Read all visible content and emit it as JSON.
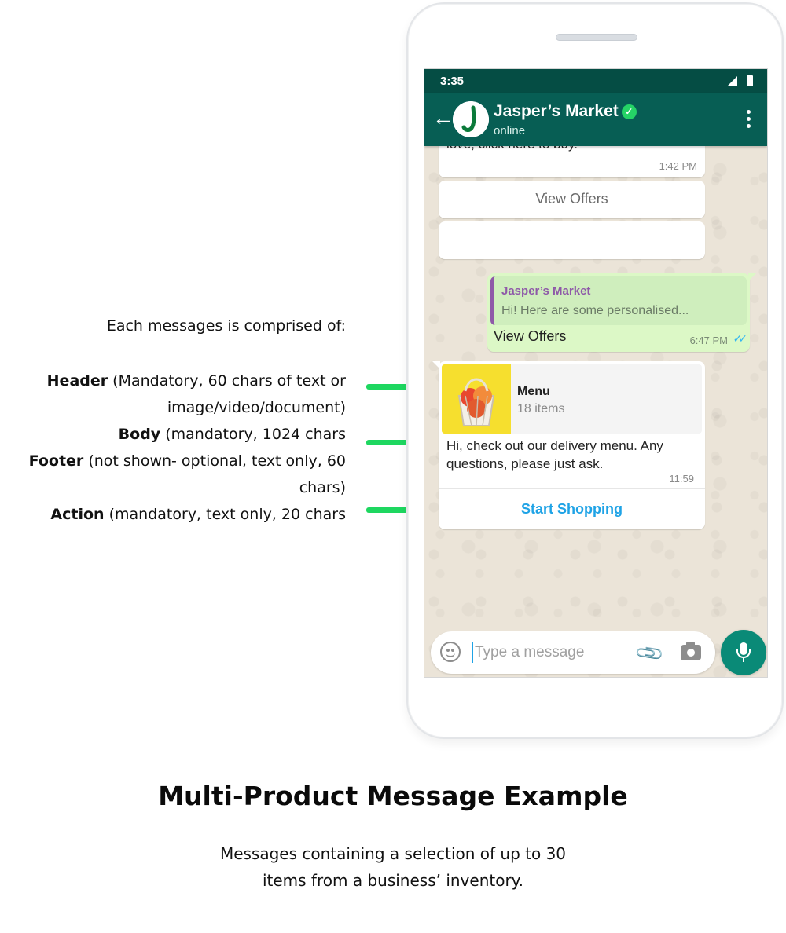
{
  "annotations": {
    "intro": "Each messages is comprised of:",
    "header_bold": "Header",
    "header_rest": " (Mandatory, 60 chars of text or image/video/document)",
    "body_bold": "Body",
    "body_rest": " (mandatory, 1024 chars",
    "footer_bold": "Footer",
    "footer_rest": " (not shown- optional, text only, 60 chars)",
    "action_bold": "Action",
    "action_rest": " (mandatory, text only, 20 chars",
    "accent_color": "#1ed760"
  },
  "phone": {
    "status_time": "3:35",
    "contact_name": "Jasper’s Market",
    "contact_status": "online",
    "verified_icon": "check-badge-icon"
  },
  "chat": {
    "cut_message_text": "love, click here to buy.",
    "cut_message_time": "1:42 PM",
    "button_view_offers": "View Offers",
    "outgoing": {
      "quote_name": "Jasper’s Market",
      "quote_text": "Hi! Here are some personalised...",
      "text": "View Offers",
      "time": "6:47 PM"
    },
    "product_message": {
      "header_title": "Menu",
      "header_count": "18 items",
      "body": "Hi, check out our delivery menu. Any questions, please just ask.",
      "time": "11:59",
      "action_label": "Start Shopping"
    },
    "composer_placeholder": "Type a message"
  },
  "caption": {
    "title": "Multi-Product Message Example",
    "text": "Messages containing a selection of up to 30 items from a business’ inventory."
  },
  "colors": {
    "header_green": "#075e54",
    "status_green": "#054d44",
    "outgoing_bubble": "#dcf8c6",
    "action_blue": "#1fa3e6",
    "mic_green": "#0a8a77"
  }
}
